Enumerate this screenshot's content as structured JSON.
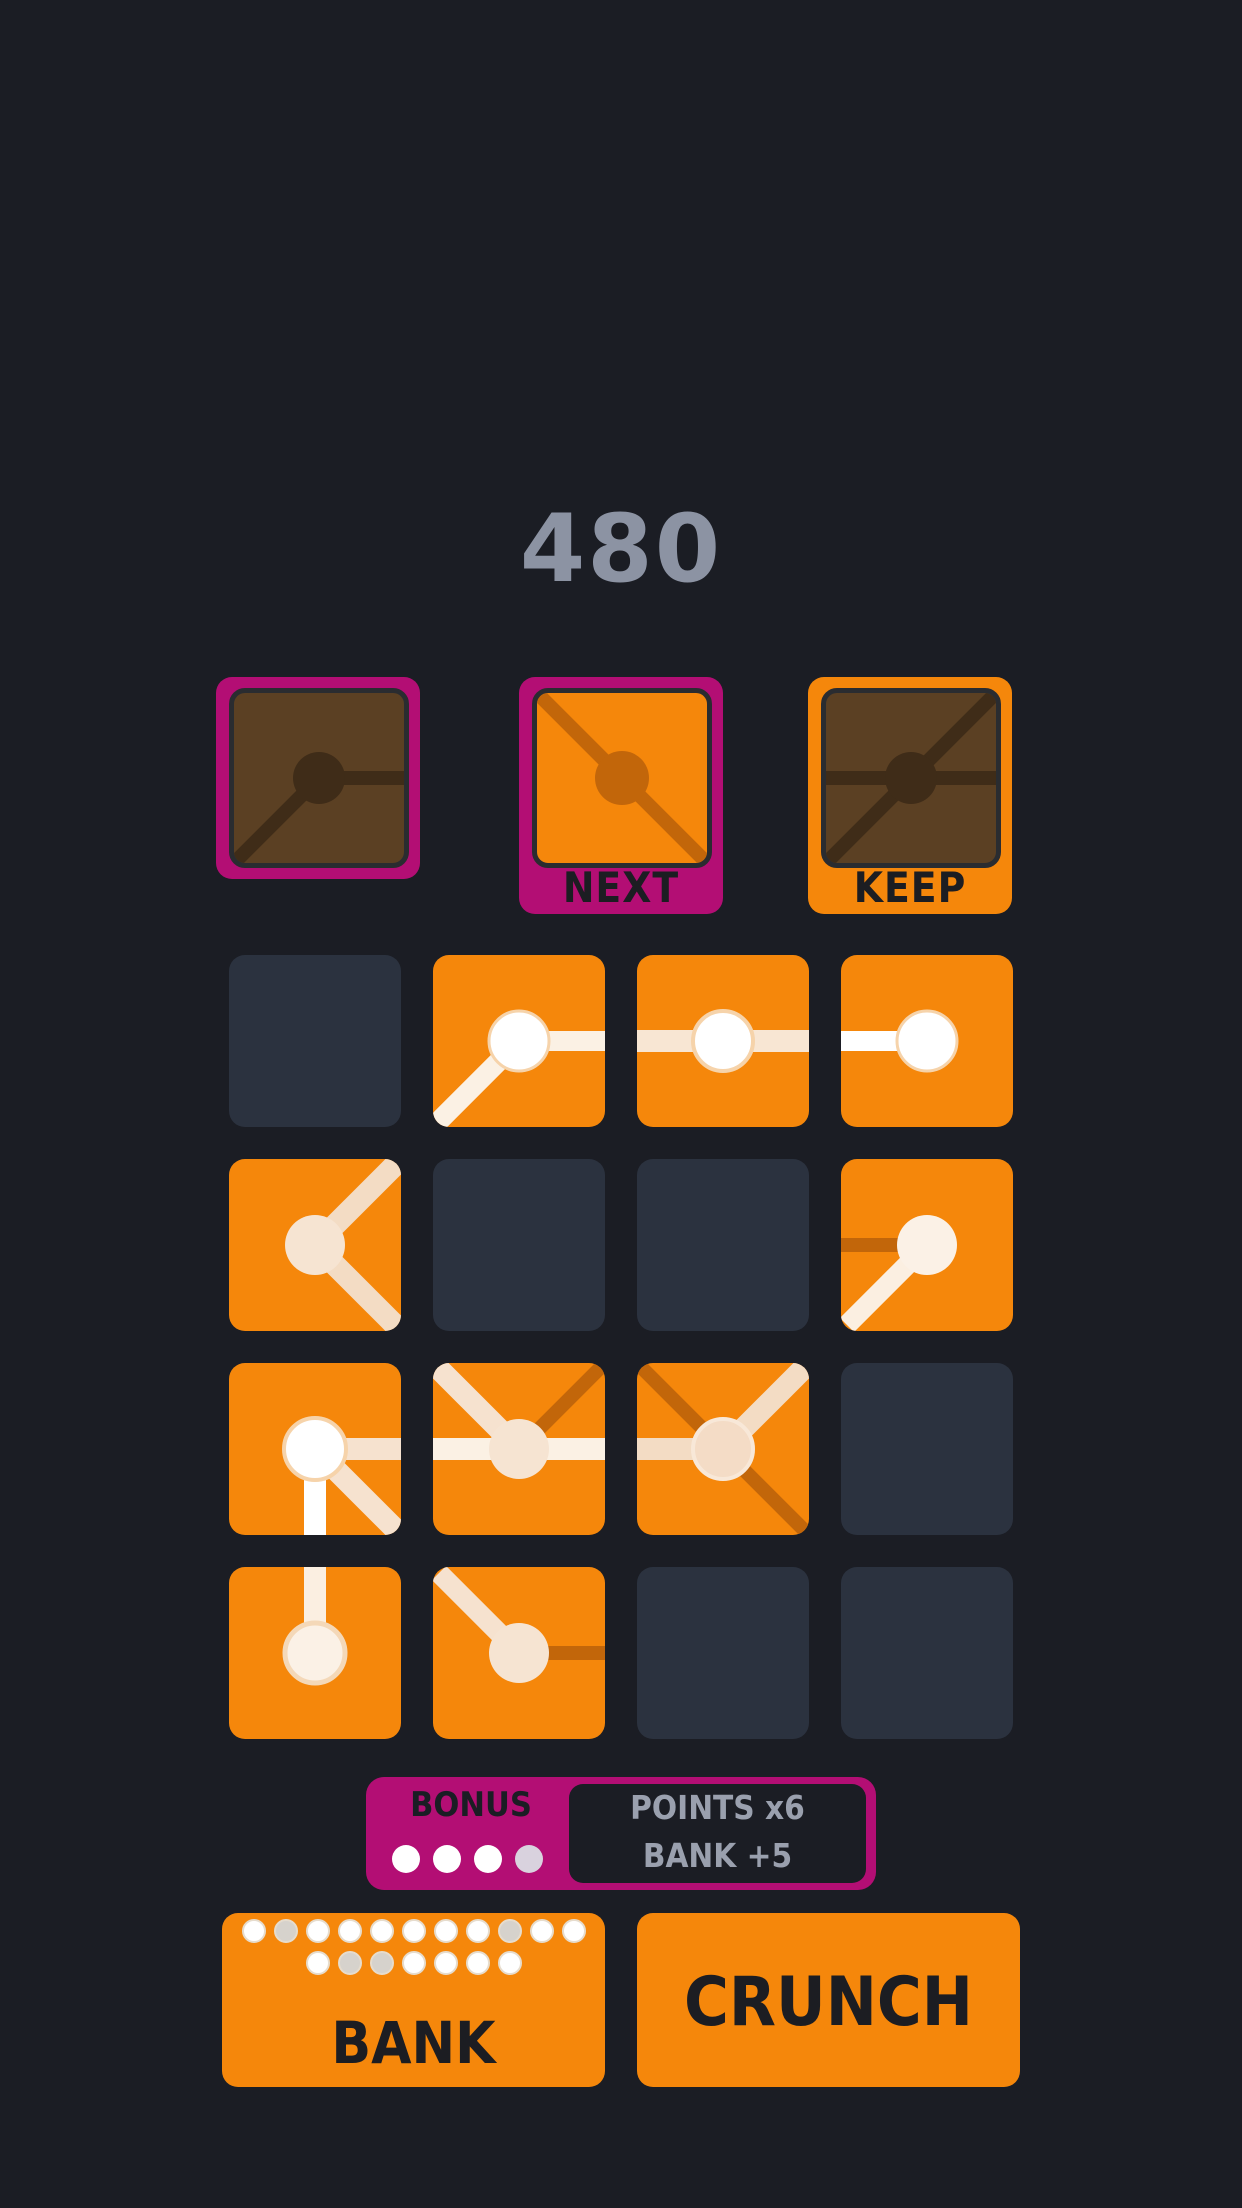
{
  "score": "480",
  "slots": {
    "current": {
      "label": ""
    },
    "next": {
      "label": "NEXT"
    },
    "keep": {
      "label": "KEEP"
    }
  },
  "board": {
    "rows": 4,
    "cols": 4,
    "cells": [
      [
        "empty",
        "filled",
        "filled",
        "filled"
      ],
      [
        "filled",
        "empty",
        "empty",
        "filled"
      ],
      [
        "filled",
        "filled",
        "filled",
        "empty"
      ],
      [
        "filled",
        "filled",
        "empty",
        "empty"
      ]
    ]
  },
  "bonus": {
    "title": "BONUS",
    "points_label": "POINTS x6",
    "bank_label": "BANK +5",
    "dots": [
      "lit",
      "lit",
      "lit",
      "dim"
    ]
  },
  "bank": {
    "label": "BANK",
    "pips_row1": [
      "lit",
      "dim",
      "lit",
      "lit",
      "lit",
      "lit",
      "lit",
      "lit",
      "dim",
      "lit",
      "lit"
    ],
    "pips_row2": [
      "lit",
      "dim",
      "dim",
      "lit",
      "lit",
      "lit",
      "lit"
    ]
  },
  "crunch": {
    "label": "CRUNCH"
  },
  "colors": {
    "background": "#1b1d24",
    "tile_orange": "#f5870b",
    "empty_cell": "#2b323f",
    "accent_magenta": "#b30e74",
    "connector_light": "#f6e6d6",
    "score_gray": "#8c93a3"
  }
}
